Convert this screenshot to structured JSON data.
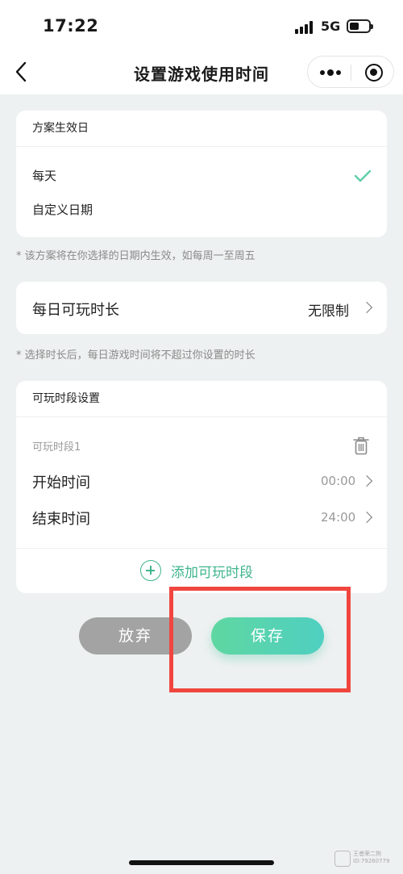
{
  "status_bar": {
    "time": "17:22",
    "network": "5G"
  },
  "nav": {
    "title": "设置游戏使用时间"
  },
  "effective_day": {
    "header": "方案生效日",
    "options": [
      "每天",
      "自定义日期"
    ],
    "selected_index": 0
  },
  "note_effective": "* 该方案将在你选择的日期内生效，如每周一至周五",
  "daily_duration": {
    "label": "每日可玩时长",
    "value": "无限制"
  },
  "note_duration": "* 选择时长后，每日游戏时间将不超过你设置的时长",
  "periods": {
    "header": "可玩时段设置",
    "items": [
      {
        "title": "可玩时段1",
        "start_label": "开始时间",
        "start_value": "00:00",
        "end_label": "结束时间",
        "end_value": "24:00"
      }
    ],
    "add_label": "添加可玩时段"
  },
  "buttons": {
    "give_up": "放弃",
    "save": "保存"
  },
  "colors": {
    "accent": "#3fb58e",
    "highlight": "#f0463f",
    "gray_button": "#a3a3a3"
  },
  "watermark": {
    "line1": "王者荣二狗",
    "line2": "ID:79260779"
  }
}
